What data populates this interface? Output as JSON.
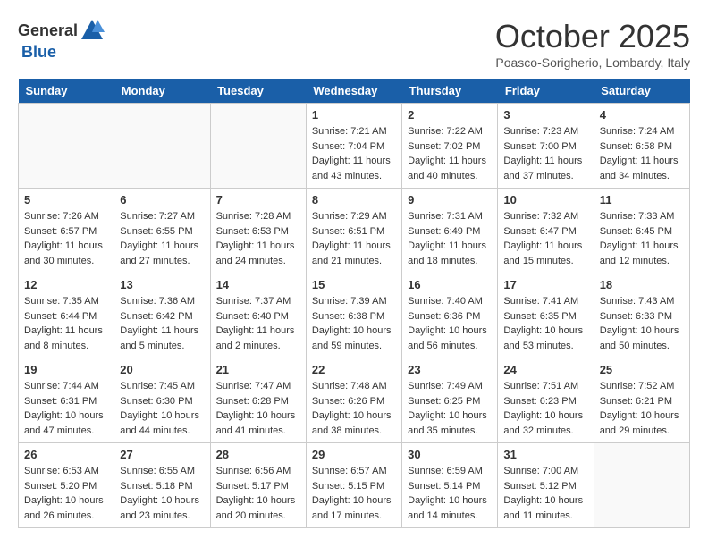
{
  "header": {
    "logo_general": "General",
    "logo_blue": "Blue",
    "month": "October 2025",
    "location": "Poasco-Sorigherio, Lombardy, Italy"
  },
  "days_of_week": [
    "Sunday",
    "Monday",
    "Tuesday",
    "Wednesday",
    "Thursday",
    "Friday",
    "Saturday"
  ],
  "weeks": [
    [
      {
        "day": "",
        "info": "",
        "empty": true
      },
      {
        "day": "",
        "info": "",
        "empty": true
      },
      {
        "day": "",
        "info": "",
        "empty": true
      },
      {
        "day": "1",
        "info": "Sunrise: 7:21 AM\nSunset: 7:04 PM\nDaylight: 11 hours\nand 43 minutes.",
        "empty": false
      },
      {
        "day": "2",
        "info": "Sunrise: 7:22 AM\nSunset: 7:02 PM\nDaylight: 11 hours\nand 40 minutes.",
        "empty": false
      },
      {
        "day": "3",
        "info": "Sunrise: 7:23 AM\nSunset: 7:00 PM\nDaylight: 11 hours\nand 37 minutes.",
        "empty": false
      },
      {
        "day": "4",
        "info": "Sunrise: 7:24 AM\nSunset: 6:58 PM\nDaylight: 11 hours\nand 34 minutes.",
        "empty": false
      }
    ],
    [
      {
        "day": "5",
        "info": "Sunrise: 7:26 AM\nSunset: 6:57 PM\nDaylight: 11 hours\nand 30 minutes.",
        "empty": false
      },
      {
        "day": "6",
        "info": "Sunrise: 7:27 AM\nSunset: 6:55 PM\nDaylight: 11 hours\nand 27 minutes.",
        "empty": false
      },
      {
        "day": "7",
        "info": "Sunrise: 7:28 AM\nSunset: 6:53 PM\nDaylight: 11 hours\nand 24 minutes.",
        "empty": false
      },
      {
        "day": "8",
        "info": "Sunrise: 7:29 AM\nSunset: 6:51 PM\nDaylight: 11 hours\nand 21 minutes.",
        "empty": false
      },
      {
        "day": "9",
        "info": "Sunrise: 7:31 AM\nSunset: 6:49 PM\nDaylight: 11 hours\nand 18 minutes.",
        "empty": false
      },
      {
        "day": "10",
        "info": "Sunrise: 7:32 AM\nSunset: 6:47 PM\nDaylight: 11 hours\nand 15 minutes.",
        "empty": false
      },
      {
        "day": "11",
        "info": "Sunrise: 7:33 AM\nSunset: 6:45 PM\nDaylight: 11 hours\nand 12 minutes.",
        "empty": false
      }
    ],
    [
      {
        "day": "12",
        "info": "Sunrise: 7:35 AM\nSunset: 6:44 PM\nDaylight: 11 hours\nand 8 minutes.",
        "empty": false
      },
      {
        "day": "13",
        "info": "Sunrise: 7:36 AM\nSunset: 6:42 PM\nDaylight: 11 hours\nand 5 minutes.",
        "empty": false
      },
      {
        "day": "14",
        "info": "Sunrise: 7:37 AM\nSunset: 6:40 PM\nDaylight: 11 hours\nand 2 minutes.",
        "empty": false
      },
      {
        "day": "15",
        "info": "Sunrise: 7:39 AM\nSunset: 6:38 PM\nDaylight: 10 hours\nand 59 minutes.",
        "empty": false
      },
      {
        "day": "16",
        "info": "Sunrise: 7:40 AM\nSunset: 6:36 PM\nDaylight: 10 hours\nand 56 minutes.",
        "empty": false
      },
      {
        "day": "17",
        "info": "Sunrise: 7:41 AM\nSunset: 6:35 PM\nDaylight: 10 hours\nand 53 minutes.",
        "empty": false
      },
      {
        "day": "18",
        "info": "Sunrise: 7:43 AM\nSunset: 6:33 PM\nDaylight: 10 hours\nand 50 minutes.",
        "empty": false
      }
    ],
    [
      {
        "day": "19",
        "info": "Sunrise: 7:44 AM\nSunset: 6:31 PM\nDaylight: 10 hours\nand 47 minutes.",
        "empty": false
      },
      {
        "day": "20",
        "info": "Sunrise: 7:45 AM\nSunset: 6:30 PM\nDaylight: 10 hours\nand 44 minutes.",
        "empty": false
      },
      {
        "day": "21",
        "info": "Sunrise: 7:47 AM\nSunset: 6:28 PM\nDaylight: 10 hours\nand 41 minutes.",
        "empty": false
      },
      {
        "day": "22",
        "info": "Sunrise: 7:48 AM\nSunset: 6:26 PM\nDaylight: 10 hours\nand 38 minutes.",
        "empty": false
      },
      {
        "day": "23",
        "info": "Sunrise: 7:49 AM\nSunset: 6:25 PM\nDaylight: 10 hours\nand 35 minutes.",
        "empty": false
      },
      {
        "day": "24",
        "info": "Sunrise: 7:51 AM\nSunset: 6:23 PM\nDaylight: 10 hours\nand 32 minutes.",
        "empty": false
      },
      {
        "day": "25",
        "info": "Sunrise: 7:52 AM\nSunset: 6:21 PM\nDaylight: 10 hours\nand 29 minutes.",
        "empty": false
      }
    ],
    [
      {
        "day": "26",
        "info": "Sunrise: 6:53 AM\nSunset: 5:20 PM\nDaylight: 10 hours\nand 26 minutes.",
        "empty": false
      },
      {
        "day": "27",
        "info": "Sunrise: 6:55 AM\nSunset: 5:18 PM\nDaylight: 10 hours\nand 23 minutes.",
        "empty": false
      },
      {
        "day": "28",
        "info": "Sunrise: 6:56 AM\nSunset: 5:17 PM\nDaylight: 10 hours\nand 20 minutes.",
        "empty": false
      },
      {
        "day": "29",
        "info": "Sunrise: 6:57 AM\nSunset: 5:15 PM\nDaylight: 10 hours\nand 17 minutes.",
        "empty": false
      },
      {
        "day": "30",
        "info": "Sunrise: 6:59 AM\nSunset: 5:14 PM\nDaylight: 10 hours\nand 14 minutes.",
        "empty": false
      },
      {
        "day": "31",
        "info": "Sunrise: 7:00 AM\nSunset: 5:12 PM\nDaylight: 10 hours\nand 11 minutes.",
        "empty": false
      },
      {
        "day": "",
        "info": "",
        "empty": true
      }
    ]
  ]
}
